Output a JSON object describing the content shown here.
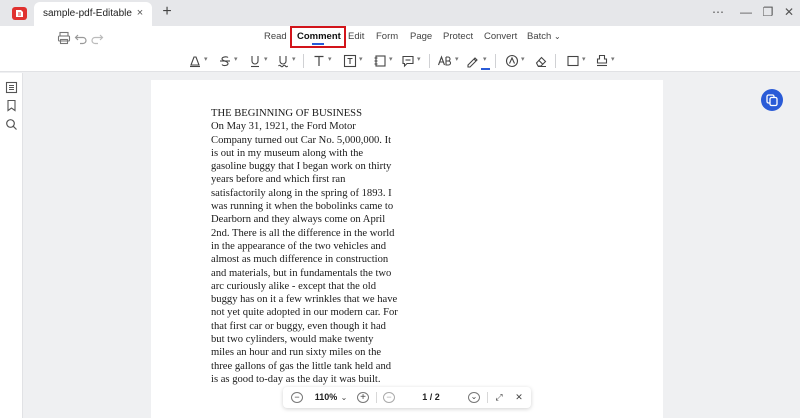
{
  "titlebar": {
    "tab_title": "sample-pdf-Editable",
    "tab_close": "×",
    "new_tab": "+",
    "more": "⋯",
    "minimize": "—",
    "restore": "❐",
    "close": "✕"
  },
  "menu": {
    "items": [
      "Read",
      "Comment",
      "Edit",
      "Form",
      "Page",
      "Protect",
      "Convert",
      "Batch"
    ],
    "active": "Comment",
    "batch_caret": "⌄"
  },
  "toolbar": {
    "tools": [
      "highlight-icon",
      "strikethrough-icon",
      "underline-icon",
      "squiggly-underline-icon",
      "text-box-icon",
      "text-callout-icon",
      "sticky-note-icon",
      "comment-icon",
      "text-format-icon",
      "pen-icon",
      "stamp-icon",
      "eraser-icon",
      "rectangle-icon",
      "signature-icon"
    ],
    "accent": "#2a5bd7",
    "active_box_color": "#d2141a"
  },
  "document": {
    "lines": [
      "THE BEGINNING OF BUSINESS",
      "On May 31, 1921, the Ford Motor",
      "Company turned out Car No. 5,000,000. It",
      "is out in my museum along with the",
      "gasoline buggy that I began work on thirty",
      "years before and which first ran",
      "satisfactorily along in the spring of 1893. I",
      "was running it when the bobolinks came to",
      "Dearborn and they always come on April",
      "2nd. There is all the difference in the world",
      "in the appearance of the two vehicles and",
      "almost as much difference in construction",
      "and materials, but in fundamentals the two",
      "arc curiously alike - except that the old",
      "buggy has on it a few wrinkles that we have",
      "not yet quite adopted in our modern car. For",
      "that first car or buggy, even though it had",
      "but two cylinders, would make twenty",
      "miles an hour and run sixty miles on the",
      "three gallons of gas the little tank held and",
      "is as good to-day as the day it was built."
    ]
  },
  "zoombar": {
    "zoom_out": "−",
    "zoom_value": "110%",
    "zoom_caret": "⌄",
    "zoom_in": "+",
    "prev_page": "−",
    "page_indicator": "1 / 2",
    "next_page": "⌄",
    "fit": "⤢",
    "close": "✕"
  }
}
